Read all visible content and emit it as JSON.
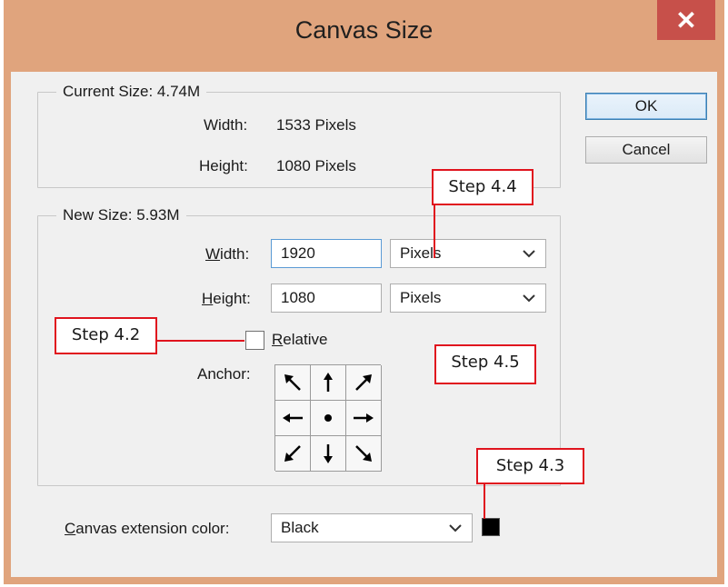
{
  "dialog": {
    "title": "Canvas Size",
    "close_label": "✕"
  },
  "current_size": {
    "legend": "Current Size: 4.74M",
    "width_label": "Width:",
    "width_value": "1533 Pixels",
    "height_label": "Height:",
    "height_value": "1080 Pixels"
  },
  "new_size": {
    "legend": "New Size: 5.93M",
    "width_label_u": "W",
    "width_label_rest": "idth:",
    "width_value": "1920",
    "width_unit": "Pixels",
    "height_label_u": "H",
    "height_label_rest": "eight:",
    "height_value": "1080",
    "height_unit": "Pixels",
    "relative_u": "R",
    "relative_rest": "elative",
    "relative_checked": false,
    "anchor_label": "Anchor:"
  },
  "extension": {
    "label_u": "C",
    "label_rest": "anvas extension color:",
    "value": "Black",
    "swatch_color": "#000000"
  },
  "buttons": {
    "ok": "OK",
    "cancel": "Cancel"
  },
  "annotations": {
    "step_4_2": "Step 4.2",
    "step_4_3": "Step 4.3",
    "step_4_4": "Step 4.4",
    "step_4_5": "Step 4.5"
  },
  "colors": {
    "titlebar": "#e0a47d",
    "close_button": "#c7504a",
    "annotation_red": "#e0141e"
  }
}
